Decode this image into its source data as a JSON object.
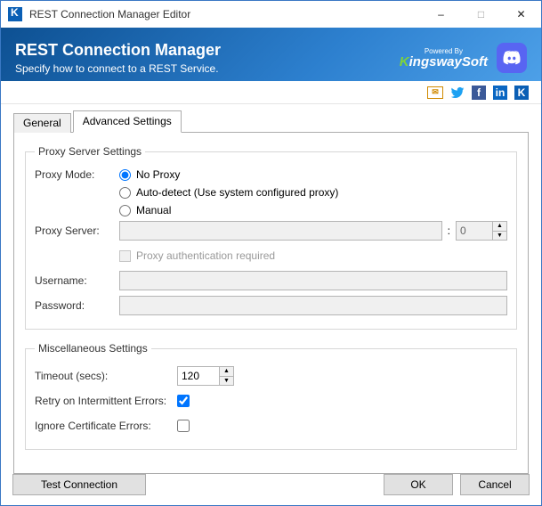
{
  "window": {
    "title": "REST Connection Manager Editor"
  },
  "banner": {
    "title": "REST Connection Manager",
    "subtitle": "Specify how to connect to a REST Service.",
    "powered_label": "Powered By",
    "brand_left": "K",
    "brand_right": "ingswaySoft"
  },
  "tabs": {
    "general": "General",
    "advanced": "Advanced Settings"
  },
  "proxy": {
    "legend": "Proxy Server Settings",
    "mode_label": "Proxy Mode:",
    "options": {
      "none": "No Proxy",
      "auto": "Auto-detect (Use system configured proxy)",
      "manual": "Manual"
    },
    "server_label": "Proxy Server:",
    "server_value": "",
    "port_value": "0",
    "auth_label": "Proxy authentication required",
    "username_label": "Username:",
    "username_value": "",
    "password_label": "Password:",
    "password_value": ""
  },
  "misc": {
    "legend": "Miscellaneous Settings",
    "timeout_label": "Timeout (secs):",
    "timeout_value": "120",
    "retry_label": "Retry on Intermittent Errors:",
    "ignore_cert_label": "Ignore Certificate Errors:"
  },
  "footer": {
    "test": "Test Connection",
    "ok": "OK",
    "cancel": "Cancel"
  }
}
